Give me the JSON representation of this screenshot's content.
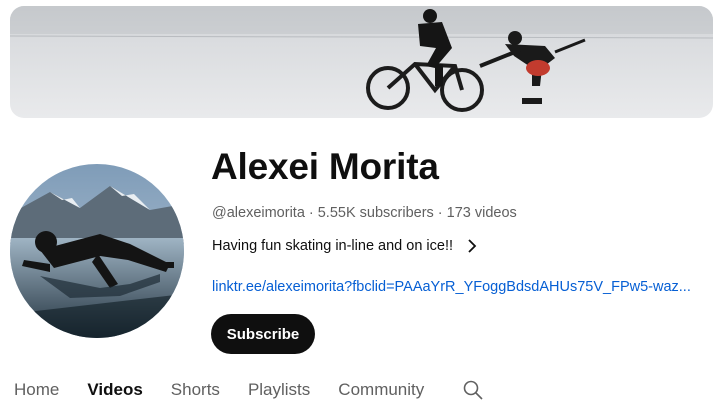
{
  "channel": {
    "name": "Alexei Morita",
    "handle": "@alexeimorita",
    "subscribers": "5.55K subscribers",
    "videos": "173 videos",
    "separator": "·",
    "description": "Having fun skating in-line and on ice!!",
    "link": "linktr.ee/alexeimorita?fbclid=PAAaYrR_YFoggBdsdAHUs75V_FPw5-waz..."
  },
  "subscribe_label": "Subscribe",
  "tabs": [
    {
      "label": "Home",
      "active": false
    },
    {
      "label": "Videos",
      "active": true
    },
    {
      "label": "Shorts",
      "active": false
    },
    {
      "label": "Playlists",
      "active": false
    },
    {
      "label": "Community",
      "active": false
    }
  ],
  "icons": {
    "description_more": "chevron-right-icon",
    "tab_search": "search-icon"
  },
  "colors": {
    "link": "#065fd4",
    "subscribe_bg": "#0f0f0f",
    "muted_text": "#606060"
  }
}
